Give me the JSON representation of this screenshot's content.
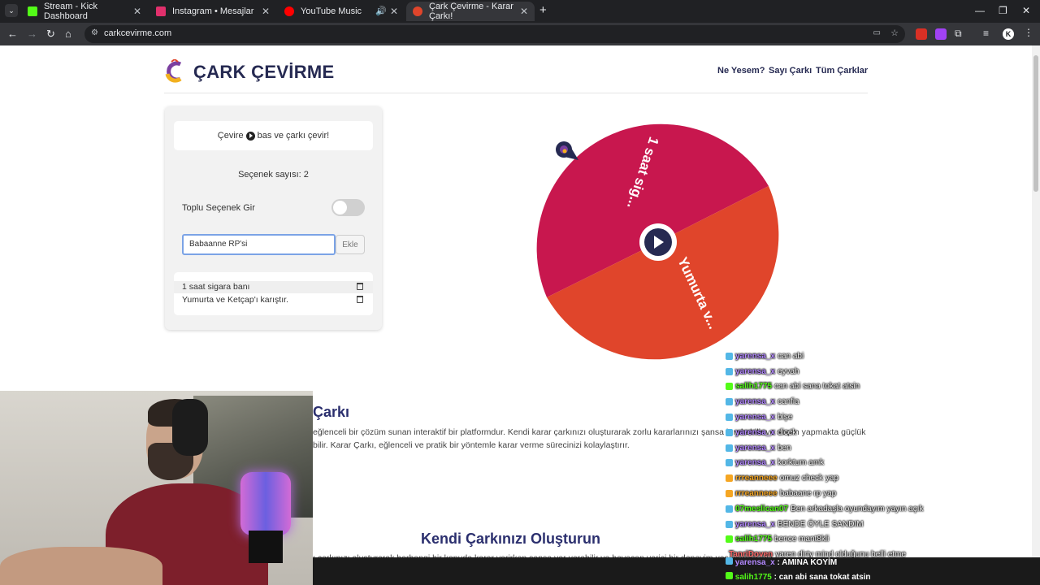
{
  "browser": {
    "tabs": [
      {
        "label": "Stream - Kick Dashboard",
        "color": "#53fc18"
      },
      {
        "label": "Instagram • Mesajlar",
        "color": "#e1306c"
      },
      {
        "label": "YouTube Music",
        "color": "#ff0000"
      },
      {
        "label": "Çark Çevirme - Karar Çarkı!",
        "color": "#e0452b"
      }
    ],
    "url": "carkcevirme.com"
  },
  "site": {
    "brand": "ÇARK ÇEVİRME",
    "nav": [
      "Ne Yesem?",
      "Sayı Çarkı",
      "Tüm Çarklar"
    ]
  },
  "panel": {
    "hint_before": "Çevire",
    "hint_after": "bas ve çarkı çevir!",
    "count_label": "Seçenek sayısı: 2",
    "bulk_label": "Toplu Seçenek Gir",
    "bulk_enabled": false,
    "input_value": "Babaanne RP'si",
    "add_label": "Ekle",
    "options": [
      "1 saat sigara banı",
      "Yumurta ve Ketçap'ı karıştır."
    ]
  },
  "wheel": {
    "slices": [
      {
        "label": "1 saat sig...",
        "color": "#c8174e"
      },
      {
        "label": "Yumurta v...",
        "color": "#e0452b"
      }
    ]
  },
  "content": {
    "section1_title": "Çarkı",
    "section1_line1": "eğlenceli bir çözüm sunan interaktif bir platformdur. Kendi karar çarkınızı oluşturarak zorlu kararlarınızı şansa bırakabilir ve seçim yapmakta güçlük",
    "section1_line2": "bilir. Karar Çarkı, eğlenceli ve pratik bir yöntemle karar verme sürecinizi kolaylaştırır.",
    "section2_title": "Kendi Çarkınızı Oluşturun",
    "section2_line1": "ı çarkınızı oluşturarak herhangi bir konuda karar verirken şansa yer verebilir ve heyecan verici bir deneyim yaşayabilirsiniz."
  },
  "chat": [
    {
      "user": "yarensa_x",
      "msg": "can abi",
      "color": "#b388ff"
    },
    {
      "user": "yarensa_x",
      "msg": "eyvah",
      "color": "#b388ff"
    },
    {
      "user": "salih1775",
      "msg": "can abi sana tokat atsin",
      "color": "#53fc18"
    },
    {
      "user": "yarensa_x",
      "msg": "canfia",
      "color": "#b388ff"
    },
    {
      "user": "yarensa_x",
      "msg": "bişe",
      "color": "#b388ff"
    },
    {
      "user": "yarensa_x",
      "msg": "dicek",
      "color": "#b388ff"
    },
    {
      "user": "yarensa_x",
      "msg": "ben",
      "color": "#b388ff"
    },
    {
      "user": "yarensa_x",
      "msg": "korktum amk",
      "color": "#b388ff"
    },
    {
      "user": "rrreanneee",
      "msg": "omuz check yap",
      "color": "#f5a623"
    },
    {
      "user": "rrreanneee",
      "msg": "babaane rp yap",
      "color": "#f5a623"
    },
    {
      "user": "07meslican07",
      "msg": "Ben arkadaşla oyundayım yayın açık",
      "color": "#53fc18"
    },
    {
      "user": "yarensa_x",
      "msg": "BENDE ÖYLE SANDIM",
      "color": "#b388ff"
    },
    {
      "user": "salih1775",
      "msg": "bence mant8kli",
      "color": "#53fc18"
    },
    {
      "user": "TanriDoven",
      "msg": "yaren dirty mind olduğunu belli etme",
      "color": "#ff6b6b"
    }
  ],
  "chatbar": {
    "line1_user": "yarensa_x",
    "line1_msg": ": AMINA KOYİM",
    "line2_user": "salih1775",
    "line2_msg": ": can abi sana tokat atsin"
  }
}
